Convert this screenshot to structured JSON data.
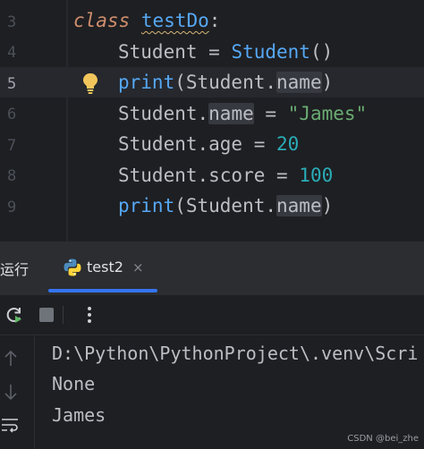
{
  "editor": {
    "line_numbers": [
      "3",
      "4",
      "5",
      "6",
      "7",
      "8",
      "9"
    ],
    "lines": {
      "l3": {
        "kw": "class",
        "name": "testDo",
        "colon": ":"
      },
      "l4": {
        "lhs": "Student = ",
        "fn": "Student",
        "rest": "()"
      },
      "l5": {
        "fn": "print",
        "p1": "(Student.",
        "attr": "name",
        "p2": ")"
      },
      "l6": {
        "p1": "Student.",
        "attr": "name",
        "p2": " = ",
        "str": "\"James\""
      },
      "l7": {
        "p1": "Student.age = ",
        "num": "20"
      },
      "l8": {
        "p1": "Student.score = ",
        "num": "100"
      },
      "l9": {
        "fn": "print",
        "p1": "(Student.",
        "attr": "name",
        "p2": ")"
      }
    },
    "current_line": "5"
  },
  "run_panel": {
    "title": "运行",
    "tab_label": "test2",
    "tab_close": "×"
  },
  "console": {
    "output": [
      "D:\\Python\\PythonProject\\.venv\\Scri",
      "None",
      "James"
    ]
  },
  "watermark": "CSDN @bei_zhe",
  "colors": {
    "background": "#1e1f22",
    "keyword": "#cf8e6d",
    "function": "#56a8f5",
    "string": "#6aab73",
    "number": "#2aacb8",
    "accent": "#3574f0"
  }
}
